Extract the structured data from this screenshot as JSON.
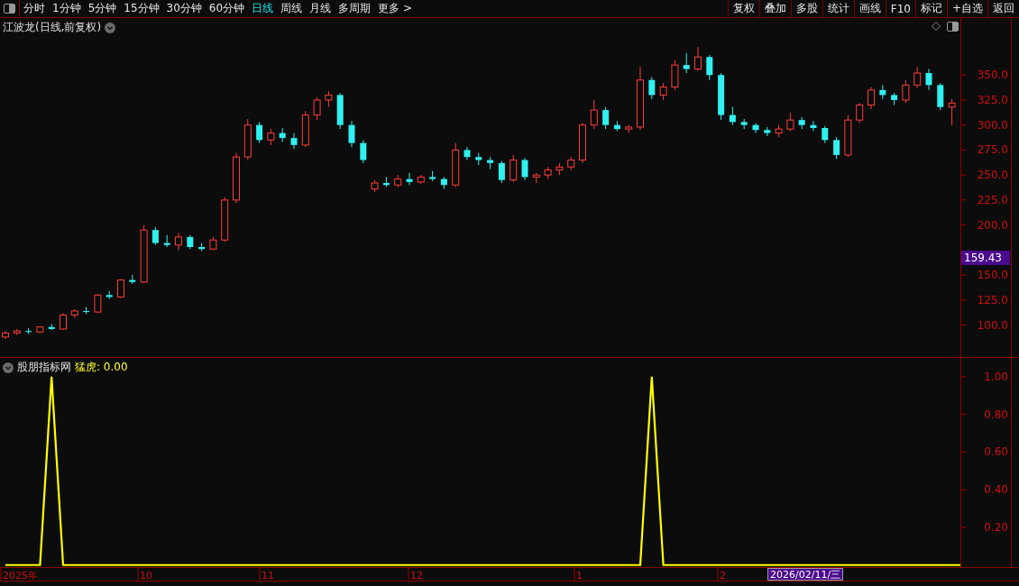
{
  "toolbar": {
    "periods": [
      {
        "label": "分时",
        "selected": false
      },
      {
        "label": "1分钟",
        "selected": false
      },
      {
        "label": "5分钟",
        "selected": false
      },
      {
        "label": "15分钟",
        "selected": false
      },
      {
        "label": "30分钟",
        "selected": false
      },
      {
        "label": "60分钟",
        "selected": false
      },
      {
        "label": "日线",
        "selected": true
      },
      {
        "label": "周线",
        "selected": false
      },
      {
        "label": "月线",
        "selected": false
      },
      {
        "label": "多周期",
        "selected": false
      },
      {
        "label": "更多 >",
        "selected": false
      }
    ],
    "buttons": [
      "复权",
      "叠加",
      "多股",
      "统计",
      "画线",
      "F10",
      "标记",
      "+自选",
      "返回"
    ]
  },
  "price_panel": {
    "title": "江波龙(日线,前复权)",
    "price_marker": "159.43",
    "chart_data": {
      "type": "candlestick",
      "ylim": [
        68,
        407
      ],
      "yticks": [
        {
          "value": 350,
          "label": "350.0"
        },
        {
          "value": 325,
          "label": "325.0"
        },
        {
          "value": 300,
          "label": "300.0"
        },
        {
          "value": 275,
          "label": "275.0"
        },
        {
          "value": 250,
          "label": "250.0"
        },
        {
          "value": 225,
          "label": "225.0"
        },
        {
          "value": 200,
          "label": "200.0"
        },
        {
          "value": 150,
          "label": "150.0"
        },
        {
          "value": 125,
          "label": "125.0"
        },
        {
          "value": 100,
          "label": "100.0"
        }
      ],
      "ohlc": [
        [
          88,
          94,
          86,
          92
        ],
        [
          92,
          96,
          90,
          94
        ],
        [
          94,
          97,
          91,
          93
        ],
        [
          93,
          99,
          92,
          98
        ],
        [
          98,
          101,
          95,
          96
        ],
        [
          96,
          112,
          95,
          110
        ],
        [
          110,
          116,
          107,
          114
        ],
        [
          114,
          118,
          111,
          113
        ],
        [
          113,
          131,
          112,
          130
        ],
        [
          130,
          134,
          126,
          128
        ],
        [
          128,
          146,
          127,
          145
        ],
        [
          145,
          150,
          141,
          143
        ],
        [
          143,
          200,
          142,
          195
        ],
        [
          195,
          198,
          180,
          182
        ],
        [
          182,
          190,
          178,
          180
        ],
        [
          180,
          192,
          175,
          188
        ],
        [
          188,
          190,
          176,
          178
        ],
        [
          178,
          182,
          174,
          176
        ],
        [
          176,
          188,
          175,
          185
        ],
        [
          185,
          228,
          183,
          225
        ],
        [
          225,
          272,
          222,
          268
        ],
        [
          268,
          306,
          265,
          300
        ],
        [
          300,
          303,
          282,
          285
        ],
        [
          285,
          296,
          280,
          292
        ],
        [
          292,
          297,
          283,
          287
        ],
        [
          287,
          292,
          276,
          280
        ],
        [
          280,
          314,
          278,
          310
        ],
        [
          310,
          328,
          305,
          325
        ],
        [
          325,
          334,
          318,
          330
        ],
        [
          330,
          332,
          296,
          300
        ],
        [
          300,
          304,
          278,
          282
        ],
        [
          282,
          285,
          262,
          265
        ],
        [
          236,
          245,
          233,
          242
        ],
        [
          242,
          248,
          238,
          240
        ],
        [
          240,
          250,
          238,
          246
        ],
        [
          246,
          252,
          240,
          243
        ],
        [
          243,
          250,
          241,
          248
        ],
        [
          248,
          254,
          244,
          246
        ],
        [
          246,
          248,
          236,
          240
        ],
        [
          240,
          282,
          238,
          275
        ],
        [
          275,
          278,
          265,
          268
        ],
        [
          268,
          272,
          260,
          265
        ],
        [
          265,
          268,
          256,
          262
        ],
        [
          262,
          264,
          242,
          245
        ],
        [
          245,
          270,
          243,
          265
        ],
        [
          265,
          267,
          245,
          248
        ],
        [
          248,
          252,
          242,
          250
        ],
        [
          250,
          258,
          246,
          255
        ],
        [
          255,
          262,
          250,
          258
        ],
        [
          258,
          268,
          255,
          265
        ],
        [
          265,
          302,
          262,
          300
        ],
        [
          300,
          325,
          296,
          315
        ],
        [
          315,
          318,
          296,
          300
        ],
        [
          300,
          304,
          294,
          296
        ],
        [
          296,
          300,
          292,
          298
        ],
        [
          298,
          358,
          295,
          345
        ],
        [
          345,
          348,
          326,
          330
        ],
        [
          330,
          342,
          325,
          338
        ],
        [
          338,
          365,
          335,
          360
        ],
        [
          360,
          372,
          352,
          356
        ],
        [
          356,
          378,
          354,
          368
        ],
        [
          368,
          370,
          345,
          350
        ],
        [
          350,
          352,
          305,
          310
        ],
        [
          310,
          318,
          300,
          303
        ],
        [
          303,
          306,
          296,
          300
        ],
        [
          300,
          302,
          292,
          295
        ],
        [
          295,
          298,
          289,
          292
        ],
        [
          292,
          300,
          288,
          296
        ],
        [
          296,
          312,
          294,
          305
        ],
        [
          305,
          308,
          296,
          300
        ],
        [
          300,
          304,
          294,
          297
        ],
        [
          297,
          299,
          282,
          285
        ],
        [
          285,
          288,
          266,
          270
        ],
        [
          270,
          310,
          268,
          305
        ],
        [
          305,
          322,
          302,
          320
        ],
        [
          320,
          338,
          316,
          335
        ],
        [
          335,
          340,
          326,
          330
        ],
        [
          330,
          332,
          320,
          325
        ],
        [
          325,
          345,
          322,
          340
        ],
        [
          340,
          358,
          337,
          352
        ],
        [
          352,
          356,
          335,
          340
        ],
        [
          340,
          342,
          315,
          318
        ],
        [
          318,
          326,
          300,
          322
        ]
      ]
    }
  },
  "indicator_panel": {
    "title": "股朋指标网",
    "legend": "猛虎: 0.00",
    "chart_data": {
      "type": "line",
      "ylim": [
        0,
        1.1
      ],
      "yticks": [
        {
          "value": 1,
          "label": "1.00"
        },
        {
          "value": 0.8,
          "label": "0.80"
        },
        {
          "value": 0.6,
          "label": "0.60"
        },
        {
          "value": 0.4,
          "label": "0.40"
        },
        {
          "value": 0.2,
          "label": "0.20"
        }
      ],
      "series": [
        {
          "color": "#ffff00",
          "values": [
            0,
            0,
            0,
            0,
            1,
            0,
            0,
            0,
            0,
            0,
            0,
            0,
            0,
            0,
            0,
            0,
            0,
            0,
            0,
            0,
            0,
            0,
            0,
            0,
            0,
            0,
            0,
            0,
            0,
            0,
            0,
            0,
            0,
            0,
            0,
            0,
            0,
            0,
            0,
            0,
            0,
            0,
            0,
            0,
            0,
            0,
            0,
            0,
            0,
            0,
            0,
            0,
            0,
            0,
            0,
            0,
            1,
            0,
            0,
            0,
            0,
            0,
            0,
            0,
            0,
            0,
            0,
            0,
            0,
            0,
            0,
            0,
            0,
            0,
            0,
            0,
            0,
            0,
            0,
            0,
            0,
            0,
            0,
            0
          ]
        }
      ]
    }
  },
  "date_axis": {
    "labels": [
      "2025年",
      "10",
      "11",
      "12",
      "1",
      "2"
    ],
    "cursor_date": "2026/02/11/三"
  }
}
